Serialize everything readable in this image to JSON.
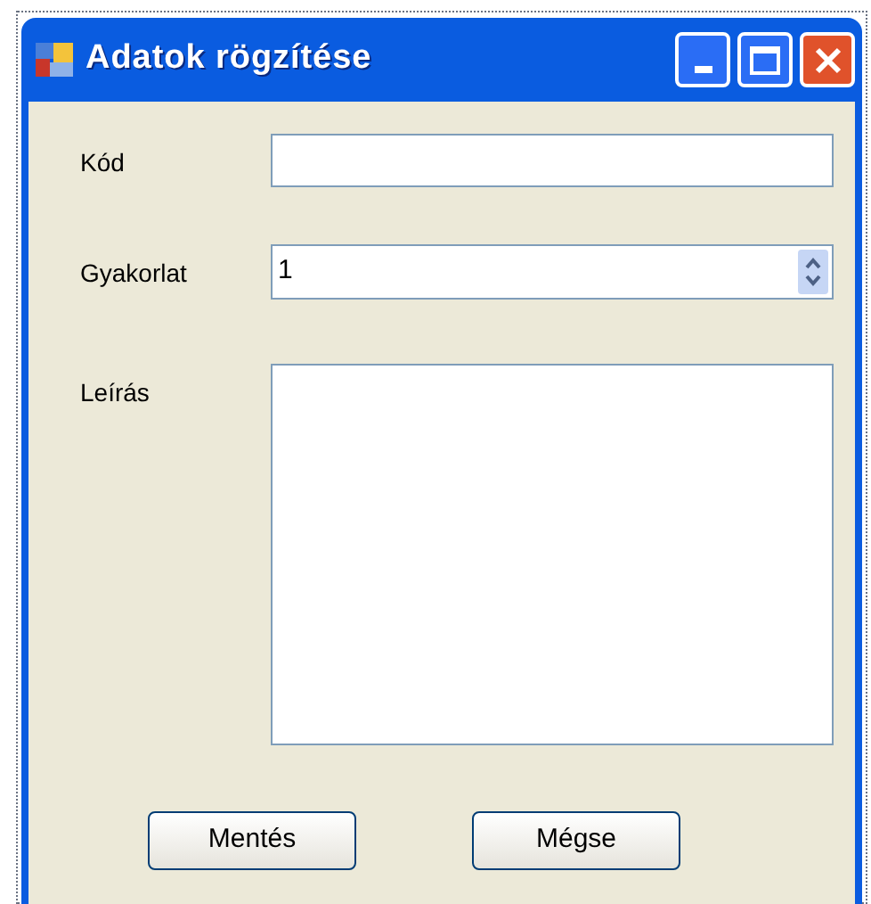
{
  "window": {
    "title": "Adatok rögzítése"
  },
  "fields": [
    {
      "label": "Kód",
      "kind": "text"
    },
    {
      "label": "Gyakorlat",
      "kind": "spinner",
      "value": "1"
    },
    {
      "label": "Leírás",
      "kind": "textarea"
    }
  ],
  "buttons": [
    "Mentés",
    "Mégse"
  ]
}
